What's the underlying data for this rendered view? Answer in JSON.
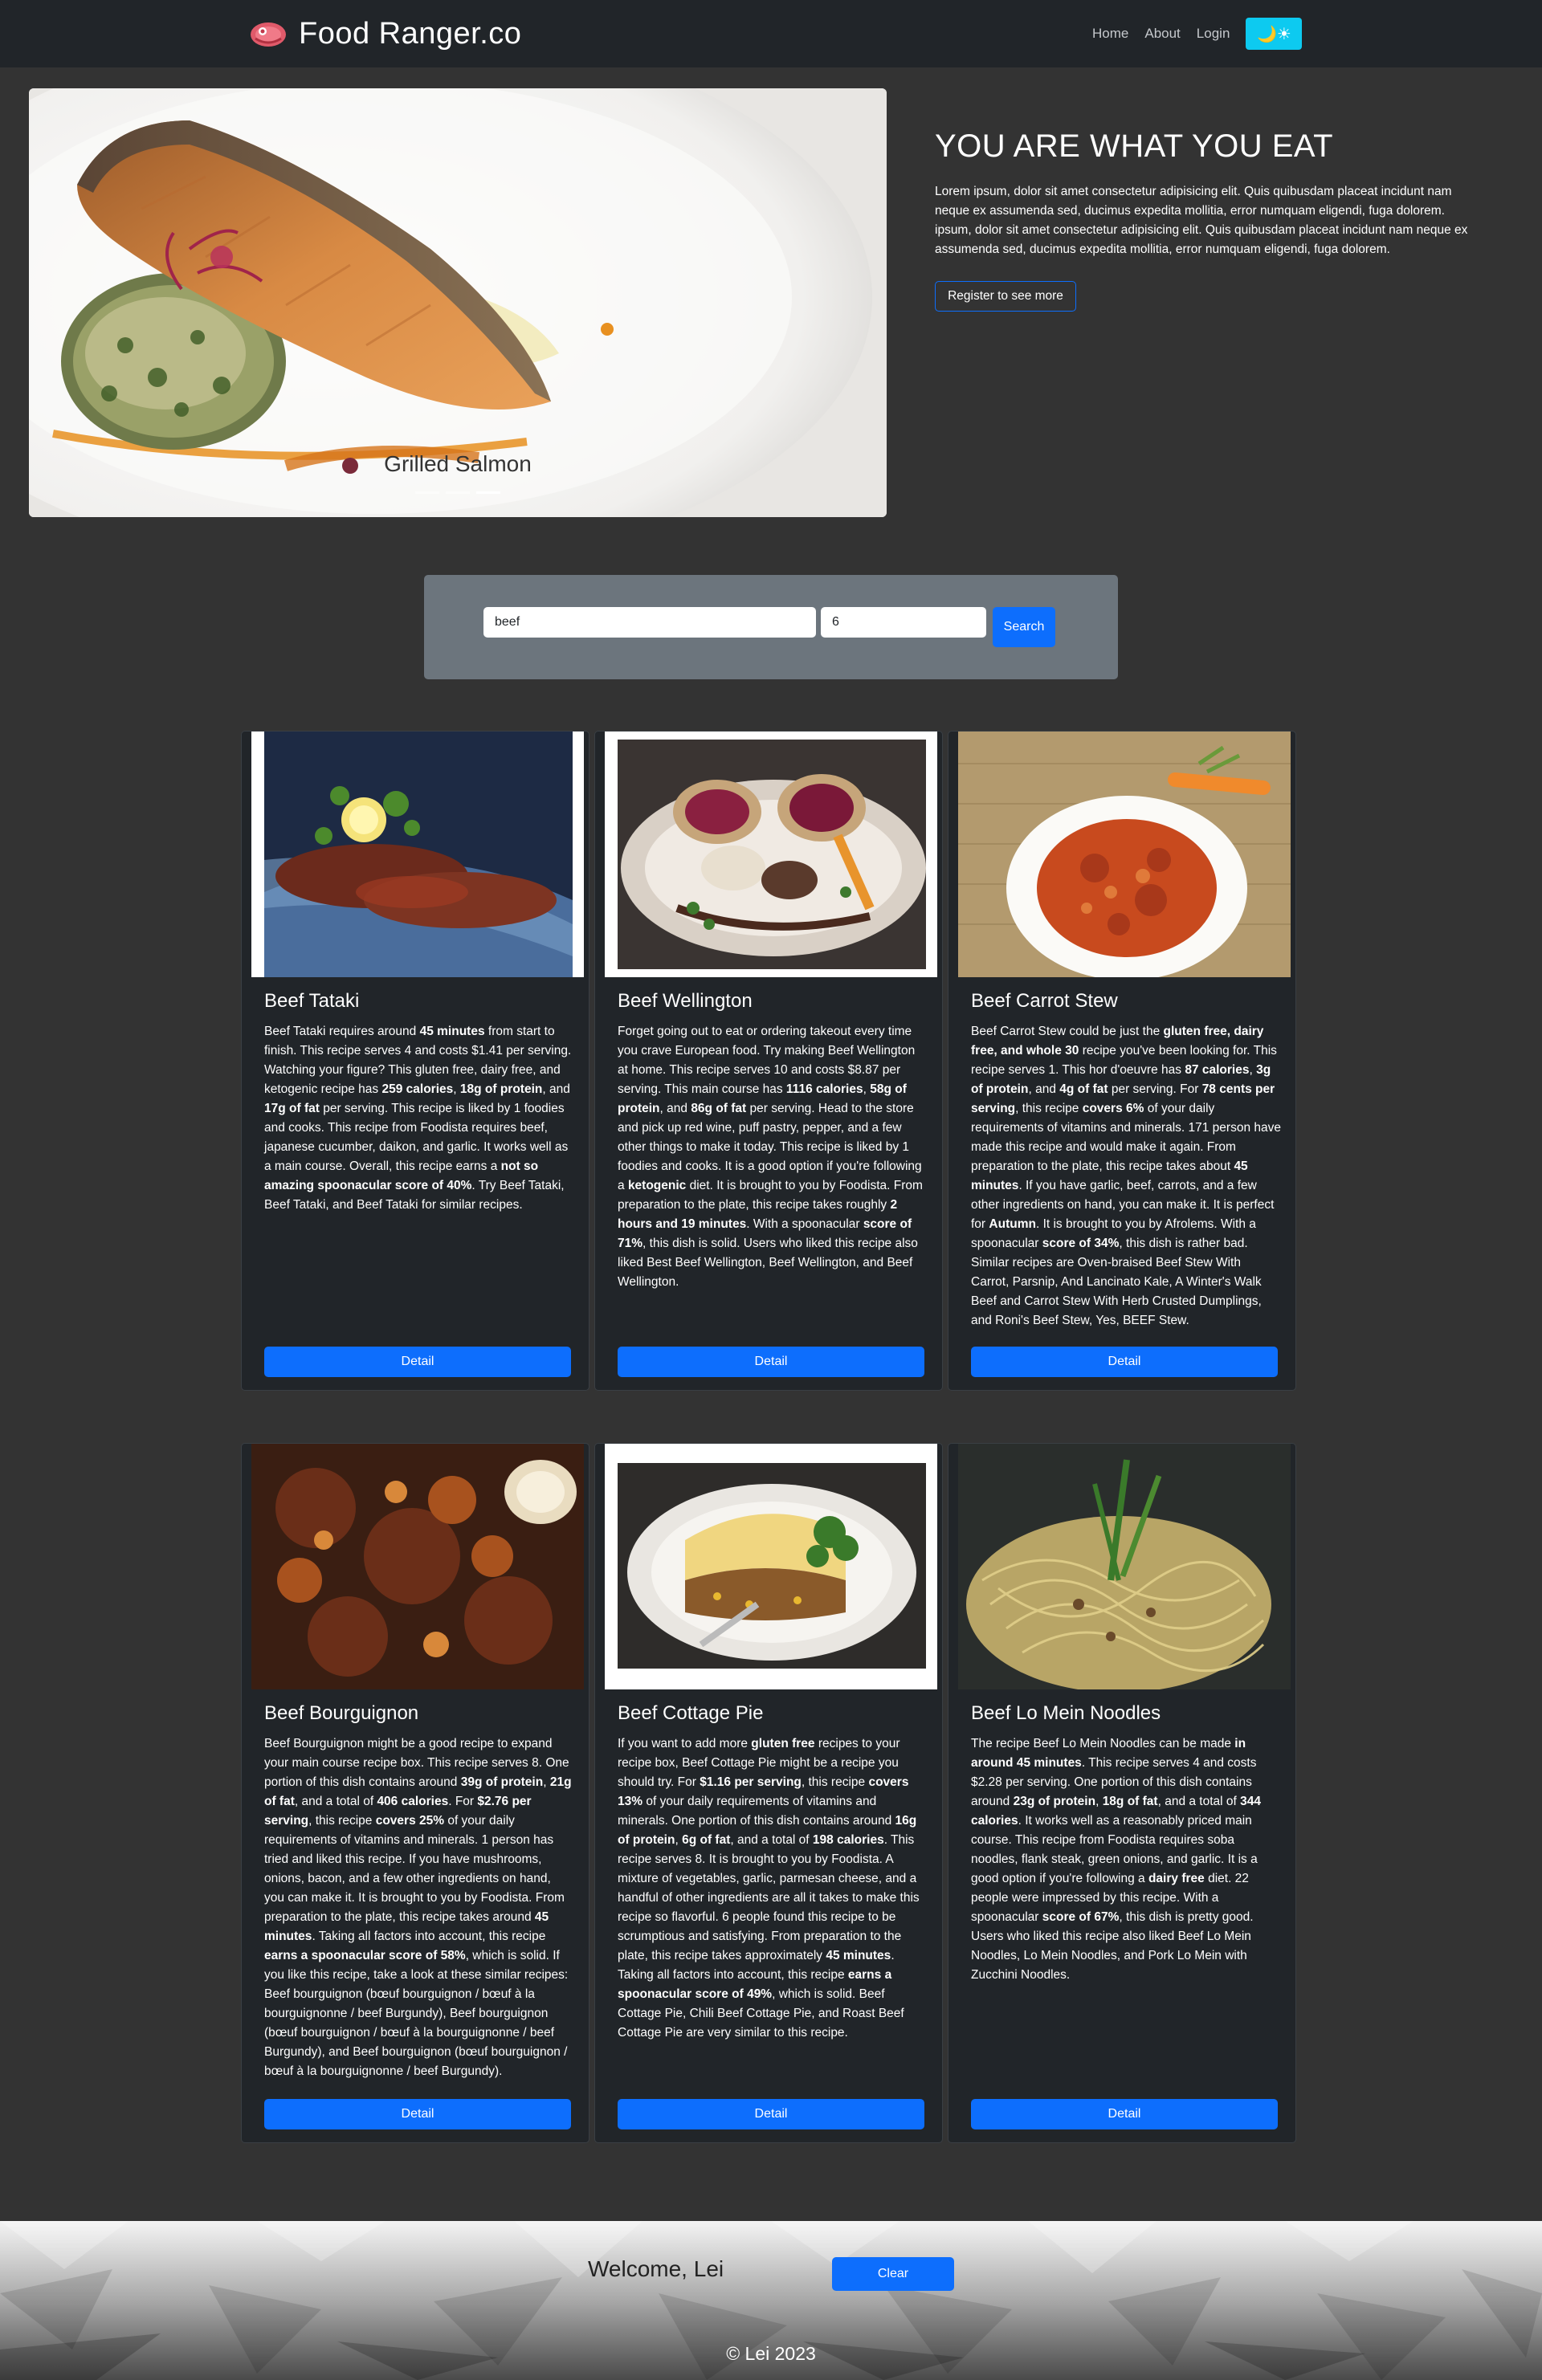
{
  "nav": {
    "brand": "Food Ranger.co",
    "links": [
      "Home",
      "About",
      "Login"
    ],
    "theme_icons": "🌙☀"
  },
  "hero": {
    "caption": "Grilled Salmon",
    "title": "YOU ARE WHAT YOU EAT",
    "body": "Lorem ipsum, dolor sit amet consectetur adipisicing elit. Quis quibusdam placeat incidunt nam neque ex assumenda sed, ducimus expedita mollitia, error numquam eligendi, fuga dolorem. ipsum, dolor sit amet consectetur adipisicing elit. Quis quibusdam placeat incidunt nam neque ex assumenda sed, ducimus expedita mollitia, error numquam eligendi, fuga dolorem.",
    "register_label": "Register to see more",
    "active_slide": 3,
    "slide_count": 3
  },
  "search": {
    "query": "beef",
    "count": "6",
    "button_label": "Search"
  },
  "cards": [
    {
      "title": "Beef Tataki",
      "image": "beef-tataki-photo",
      "detail_label": "Detail",
      "summary": "Beef Tataki requires around <b>45 minutes</b> from start to finish. This recipe serves 4 and costs $1.41 per serving. Watching your figure? This gluten free, dairy free, and ketogenic recipe has <b>259 calories</b>, <b>18g of protein</b>, and <b>17g of fat</b> per serving. This recipe is liked by 1 foodies and cooks. This recipe from Foodista requires beef, japanese cucumber, daikon, and garlic. It works well as a main course. Overall, this recipe earns a <b>not so amazing spoonacular score of 40%</b>. Try Beef Tataki, Beef Tataki, and Beef Tataki for similar recipes."
    },
    {
      "title": "Beef Wellington",
      "image": "beef-wellington-photo",
      "detail_label": "Detail",
      "summary": "Forget going out to eat or ordering takeout every time you crave European food. Try making Beef Wellington at home. This recipe serves 10 and costs $8.87 per serving. This main course has <b>1116 calories</b>, <b>58g of protein</b>, and <b>86g of fat</b> per serving. Head to the store and pick up red wine, puff pastry, pepper, and a few other things to make it today. This recipe is liked by 1 foodies and cooks. It is a good option if you're following a <b>ketogenic</b> diet. It is brought to you by Foodista. From preparation to the plate, this recipe takes roughly <b>2 hours and 19 minutes</b>. With a spoonacular <b>score of 71%</b>, this dish is solid. Users who liked this recipe also liked Best Beef Wellington, Beef Wellington, and Beef Wellington."
    },
    {
      "title": "Beef Carrot Stew",
      "image": "beef-carrot-stew-photo",
      "detail_label": "Detail",
      "summary": "Beef Carrot Stew could be just the <b>gluten free, dairy free, and whole 30</b> recipe you've been looking for. This recipe serves 1. This hor d'oeuvre has <b>87 calories</b>, <b>3g of protein</b>, and <b>4g of fat</b> per serving. For <b>78 cents per serving</b>, this recipe <b>covers 6%</b> of your daily requirements of vitamins and minerals. 171 person have made this recipe and would make it again. From preparation to the plate, this recipe takes about <b>45 minutes</b>. If you have garlic, beef, carrots, and a few other ingredients on hand, you can make it. It is perfect for <b>Autumn</b>. It is brought to you by Afrolems. With a spoonacular <b>score of 34%</b>, this dish is rather bad. Similar recipes are Oven-braised Beef Stew With Carrot, Parsnip, And Lancinato Kale, A Winter's Walk Beef and Carrot Stew With Herb Crusted Dumplings, and Roni's Beef Stew, Yes, BEEF Stew."
    },
    {
      "title": "Beef Bourguignon",
      "image": "beef-bourguignon-photo",
      "detail_label": "Detail",
      "summary": "Beef Bourguignon might be a good recipe to expand your main course recipe box. This recipe serves 8. One portion of this dish contains around <b>39g of protein</b>, <b>21g of fat</b>, and a total of <b>406 calories</b>. For <b>$2.76 per serving</b>, this recipe <b>covers 25%</b> of your daily requirements of vitamins and minerals. 1 person has tried and liked this recipe. If you have mushrooms, onions, bacon, and a few other ingredients on hand, you can make it. It is brought to you by Foodista. From preparation to the plate, this recipe takes around <b>45 minutes</b>. Taking all factors into account, this recipe <b>earns a spoonacular score of 58%</b>, which is solid. If you like this recipe, take a look at these similar recipes: Beef bourguignon (bœuf bourguignon / bœuf à la bourguignonne / beef Burgundy), Beef bourguignon (bœuf bourguignon / bœuf à la bourguignonne / beef Burgundy), and Beef bourguignon (bœuf bourguignon / bœuf à la bourguignonne / beef Burgundy)."
    },
    {
      "title": "Beef Cottage Pie",
      "image": "beef-cottage-pie-photo",
      "detail_label": "Detail",
      "summary": "If you want to add more <b>gluten free</b> recipes to your recipe box, Beef Cottage Pie might be a recipe you should try. For <b>$1.16 per serving</b>, this recipe <b>covers 13%</b> of your daily requirements of vitamins and minerals. One portion of this dish contains around <b>16g of protein</b>, <b>6g of fat</b>, and a total of <b>198 calories</b>. This recipe serves 8. It is brought to you by Foodista. A mixture of vegetables, garlic, parmesan cheese, and a handful of other ingredients are all it takes to make this recipe so flavorful. 6 people found this recipe to be scrumptious and satisfying. From preparation to the plate, this recipe takes approximately <b>45 minutes</b>. Taking all factors into account, this recipe <b>earns a spoonacular score of 49%</b>, which is solid. Beef Cottage Pie, Chili Beef Cottage Pie, and Roast Beef Cottage Pie are very similar to this recipe."
    },
    {
      "title": "Beef Lo Mein Noodles",
      "image": "beef-lo-mein-photo",
      "detail_label": "Detail",
      "summary": "The recipe Beef Lo Mein Noodles can be made <b>in around 45 minutes</b>. This recipe serves 4 and costs $2.28 per serving. One portion of this dish contains around <b>23g of protein</b>, <b>18g of fat</b>, and a total of <b>344 calories</b>. It works well as a reasonably priced main course. This recipe from Foodista requires soba noodles, flank steak, green onions, and garlic. It is a good option if you're following a <b>dairy free</b> diet. 22 people were impressed by this recipe. With a spoonacular <b>score of 67%</b>, this dish is pretty good. Users who liked this recipe also liked Beef Lo Mein Noodles, Lo Mein Noodles, and Pork Lo Mein with Zucchini Noodles."
    }
  ],
  "footer": {
    "welcome": "Welcome, Lei",
    "clear_label": "Clear",
    "copyright": "© Lei 2023"
  },
  "colors": {
    "page_bg": "#333333",
    "navbar_bg": "#212529",
    "card_bg": "#212529",
    "primary": "#0d6efd",
    "toggle": "#0dcaf0",
    "search_panel": "#6c757d"
  }
}
